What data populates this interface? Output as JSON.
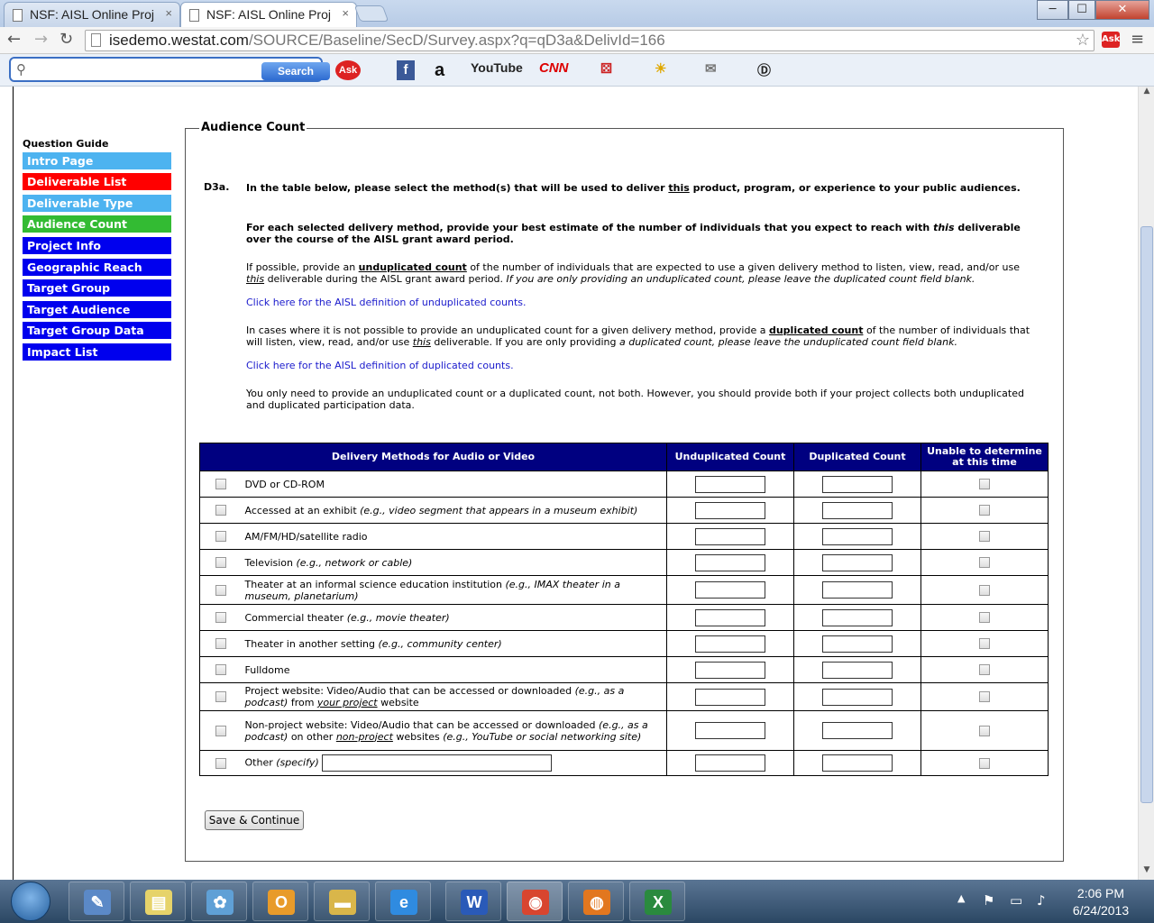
{
  "browser": {
    "tabs": [
      {
        "title": "NSF: AISL Online Proj"
      },
      {
        "title": "NSF: AISL Online Proj"
      }
    ],
    "url_host": "isedemo.westat.com",
    "url_path": "/SOURCE/Baseline/SecD/Survey.aspx?q=qD3a&DelivId=166",
    "window_controls": {
      "minimize": "─",
      "maximize": "☐",
      "close": "✕"
    }
  },
  "toolbar": {
    "search_button": "Search",
    "ask_label": "Ask",
    "facebook": "f",
    "amazon": "a",
    "youtube": "YouTube",
    "cnn": "CNN"
  },
  "sidebar": {
    "heading": "Question Guide",
    "items": [
      {
        "label": "Intro Page",
        "color": "#4db3f0"
      },
      {
        "label": "Deliverable List",
        "color": "#ff0000"
      },
      {
        "label": "Deliverable Type",
        "color": "#4db3f0"
      },
      {
        "label": "Audience Count",
        "color": "#33bb33"
      },
      {
        "label": "Project Info",
        "color": "#0000ee"
      },
      {
        "label": "Geographic Reach",
        "color": "#0000ee"
      },
      {
        "label": "Target Group",
        "color": "#0000ee"
      },
      {
        "label": "Target Audience",
        "color": "#0000ee"
      },
      {
        "label": "Target Group Data",
        "color": "#0000ee"
      },
      {
        "label": "Impact List",
        "color": "#0000ee"
      }
    ]
  },
  "section": {
    "legend": "Audience Count",
    "question_number": "D3a.",
    "p1_a": "In the table below, please select the method(s) that will be used to deliver ",
    "p1_b": "this",
    "p1_c": " product, program, or experience to your public audiences.",
    "p2_a": "For each selected delivery method, provide your best estimate of the number of individuals that you expect to reach with ",
    "p2_b": "this",
    "p2_c": " deliverable over the course of the AISL grant award period.",
    "p3_a": "If possible, provide an ",
    "p3_b": "unduplicated count",
    "p3_c": " of the number of individuals that are expected to use a given delivery method to listen, view, read, and/or use ",
    "p3_d": "this",
    "p3_e": " deliverable during the AISL grant award period. ",
    "p3_f": "If you are only providing an unduplicated count, please leave the duplicated count field blank.",
    "link_unduplicated": "Click here for the AISL definition of unduplicated counts.",
    "p4_a": "In cases where it is not possible to provide an unduplicated count for a given delivery method, provide a ",
    "p4_b": "duplicated count",
    "p4_c": " of the number of individuals that will listen, view, read, and/or use ",
    "p4_d": "this",
    "p4_e": " deliverable. If you are only providing ",
    "p4_f": "a duplicated count, please leave the unduplicated count field blank.",
    "link_duplicated": "Click here for the AISL definition of duplicated counts.",
    "p5": "You only need to provide an unduplicated count or a duplicated count, not both. However, you should provide both if your project collects both unduplicated and duplicated participation data."
  },
  "table": {
    "headers": [
      "Delivery Methods for Audio or Video",
      "Unduplicated Count",
      "Duplicated Count",
      "Unable to determine at this time"
    ],
    "rows": [
      {
        "text": "DVD or CD-ROM",
        "note": ""
      },
      {
        "text": "Accessed at an exhibit ",
        "note": "(e.g., video segment that appears in a museum exhibit)"
      },
      {
        "text": "AM/FM/HD/satellite radio",
        "note": ""
      },
      {
        "text": "Television ",
        "note": "(e.g., network or cable)"
      },
      {
        "text": "Theater at an informal science education institution ",
        "note": "(e.g., IMAX theater in a museum, planetarium)"
      },
      {
        "text": "Commercial theater ",
        "note": "(e.g., movie theater)"
      },
      {
        "text": "Theater in another setting ",
        "note": "(e.g., community center)"
      },
      {
        "text": "Fulldome",
        "note": ""
      },
      {
        "text": "Project website: Video/Audio that can be accessed or downloaded ",
        "note": "(e.g., as a podcast)",
        "tail_a": " from ",
        "tail_b": "your project",
        "tail_c": " website"
      },
      {
        "text": "Non-project website: Video/Audio that can be accessed or downloaded ",
        "note": "(e.g., as a podcast)",
        "tail_a": " on other ",
        "tail_b": "non-project",
        "tail_c": " websites ",
        "tail_d": "(e.g., YouTube or social networking site)"
      },
      {
        "text": "Other ",
        "note": "(specify)"
      }
    ]
  },
  "save_button": "Save & Continue",
  "taskbar": {
    "time": "2:06 PM",
    "date": "6/24/2013",
    "apps": [
      {
        "icon": "notepad-icon",
        "glyph": "✎",
        "color": "#5b89c7"
      },
      {
        "icon": "sticky-notes-icon",
        "glyph": "▤",
        "color": "#e6d36a"
      },
      {
        "icon": "paint-icon",
        "glyph": "✿",
        "color": "#5fa0d6"
      },
      {
        "icon": "outlook-icon",
        "glyph": "O",
        "color": "#e89b2a"
      },
      {
        "icon": "folder-icon",
        "glyph": "▬",
        "color": "#d9b64a"
      },
      {
        "icon": "ie-icon",
        "glyph": "e",
        "color": "#2f8be0"
      },
      {
        "icon": "word-icon",
        "glyph": "W",
        "color": "#2a5ab8"
      },
      {
        "icon": "chrome-icon",
        "glyph": "◉",
        "color": "#d8452f"
      },
      {
        "icon": "firefox-icon",
        "glyph": "◍",
        "color": "#e2771f"
      },
      {
        "icon": "excel-icon",
        "glyph": "X",
        "color": "#2a8a3e"
      }
    ]
  }
}
